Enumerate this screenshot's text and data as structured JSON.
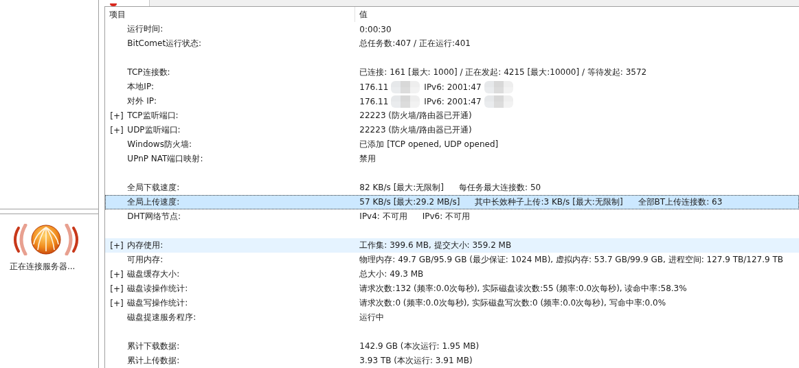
{
  "sidebar": {
    "status_text": "正在连接服务器..."
  },
  "table": {
    "columns": [
      "项目",
      "值"
    ],
    "rows": [
      {
        "kind": "data",
        "label": "运行时间:",
        "values": [
          "0:00:30"
        ],
        "selected": false,
        "highlighted": false
      },
      {
        "kind": "data",
        "label": "BitComet运行状态:",
        "values": [
          "总任务数:407 / 正在运行:401"
        ],
        "selected": false,
        "highlighted": false
      },
      {
        "kind": "spacer"
      },
      {
        "kind": "data",
        "label": "TCP连接数:",
        "values": [
          "已连接: 161 [最大: 1000] / 正在发起: 4215 [最大:10000] / 等待发起: 3572"
        ],
        "selected": false,
        "highlighted": false
      },
      {
        "kind": "data",
        "label": "本地IP:",
        "values": [
          "176.11",
          "IPv6: 2001:47"
        ],
        "redacted": true,
        "selected": false,
        "highlighted": false
      },
      {
        "kind": "data",
        "label": "对外 IP:",
        "values": [
          "176.11",
          "IPv6: 2001:47"
        ],
        "redacted": true,
        "selected": false,
        "highlighted": false
      },
      {
        "kind": "data",
        "toggle": "[+]",
        "label": "TCP监听端口:",
        "values": [
          "22223 (防火墙/路由器已开通)"
        ],
        "selected": false,
        "highlighted": false
      },
      {
        "kind": "data",
        "toggle": "[+]",
        "label": "UDP监听端口:",
        "values": [
          "22223 (防火墙/路由器已开通)"
        ],
        "selected": false,
        "highlighted": false
      },
      {
        "kind": "data",
        "label": "Windows防火墙:",
        "values": [
          "已添加 [TCP opened, UDP opened]"
        ],
        "selected": false,
        "highlighted": false
      },
      {
        "kind": "data",
        "label": "UPnP NAT端口映射:",
        "values": [
          "禁用"
        ],
        "selected": false,
        "highlighted": false
      },
      {
        "kind": "spacer"
      },
      {
        "kind": "data",
        "label": "全局下载速度:",
        "values": [
          "82 KB/s [最大:无限制]",
          "每任务最大连接数: 50"
        ],
        "selected": false,
        "highlighted": false
      },
      {
        "kind": "data",
        "label": "全局上传速度:",
        "values": [
          "57 KB/s [最大:29.2 MB/s]",
          "其中长效种子上传:3 KB/s [最大:无限制]",
          "全部BT上传连接数: 63"
        ],
        "selected": true,
        "highlighted": false
      },
      {
        "kind": "data",
        "label": "DHT网络节点:",
        "values": [
          "IPv4: 不可用",
          "IPv6: 不可用"
        ],
        "selected": false,
        "highlighted": false
      },
      {
        "kind": "spacer"
      },
      {
        "kind": "data",
        "toggle": "[+]",
        "label": "内存使用:",
        "values": [
          "工作集: 399.6 MB, 提交大小: 359.2 MB"
        ],
        "selected": false,
        "highlighted": true
      },
      {
        "kind": "data",
        "label": "可用内存:",
        "values": [
          "物理内存: 49.7 GB/95.9 GB (最少保证: 1024 MB), 虚拟内存: 53.7 GB/99.9 GB, 进程空间: 127.9 TB/127.9 TB"
        ],
        "selected": false,
        "highlighted": false
      },
      {
        "kind": "data",
        "toggle": "[+]",
        "label": "磁盘缓存大小:",
        "values": [
          "总大小:  49.3 MB"
        ],
        "selected": false,
        "highlighted": false
      },
      {
        "kind": "data",
        "toggle": "[+]",
        "label": "磁盘读操作统计:",
        "values": [
          "请求次数:132 (频率:0.0次每秒), 实际磁盘读次数:55 (频率:0.0次每秒), 读命中率:58.3%"
        ],
        "selected": false,
        "highlighted": false
      },
      {
        "kind": "data",
        "toggle": "[+]",
        "label": "磁盘写操作统计:",
        "values": [
          "请求次数:0 (频率:0.0次每秒), 实际磁盘写次数:0 (频率:0.0次每秒), 写命中率:0.0%"
        ],
        "selected": false,
        "highlighted": false
      },
      {
        "kind": "data",
        "label": "磁盘提速服务程序:",
        "values": [
          "运行中"
        ],
        "selected": false,
        "highlighted": false
      },
      {
        "kind": "spacer"
      },
      {
        "kind": "data",
        "label": "累计下载数据:",
        "values": [
          "142.9 GB (本次运行: 1.95 MB)"
        ],
        "selected": false,
        "highlighted": false
      },
      {
        "kind": "data",
        "label": "累计上传数据:",
        "values": [
          "3.93 TB (本次运行: 3.91 MB)"
        ],
        "selected": false,
        "highlighted": false
      }
    ]
  }
}
